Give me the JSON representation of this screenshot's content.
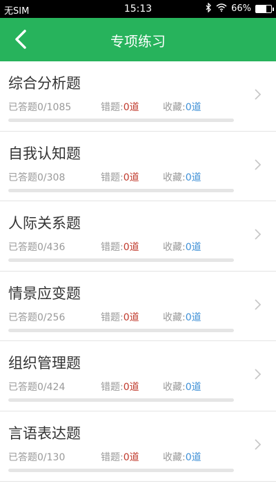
{
  "status": {
    "carrier": "无SIM",
    "time": "15:13",
    "battery": "66%",
    "battery_level": 0.66
  },
  "header": {
    "title": "专项练习"
  },
  "labels": {
    "answered_prefix": "已答题",
    "wrong_prefix": "错题:",
    "fav_prefix": "收藏:",
    "unit": "道"
  },
  "items": [
    {
      "title": "综合分析题",
      "answered": "0/1085",
      "wrong": "0",
      "fav": "0",
      "progress": 0
    },
    {
      "title": "自我认知题",
      "answered": "0/308",
      "wrong": "0",
      "fav": "0",
      "progress": 0
    },
    {
      "title": "人际关系题",
      "answered": "0/436",
      "wrong": "0",
      "fav": "0",
      "progress": 0
    },
    {
      "title": "情景应变题",
      "answered": "0/256",
      "wrong": "0",
      "fav": "0",
      "progress": 0
    },
    {
      "title": "组织管理题",
      "answered": "0/424",
      "wrong": "0",
      "fav": "0",
      "progress": 0
    },
    {
      "title": "言语表达题",
      "answered": "0/130",
      "wrong": "0",
      "fav": "0",
      "progress": 0
    }
  ],
  "colors": {
    "accent": "#27b35c",
    "wrong": "#c0392b",
    "fav": "#3d8fd6"
  },
  "icons": [
    "back-arrow-icon",
    "bluetooth-icon",
    "wifi-icon",
    "battery-icon",
    "chevron-right-icon"
  ]
}
